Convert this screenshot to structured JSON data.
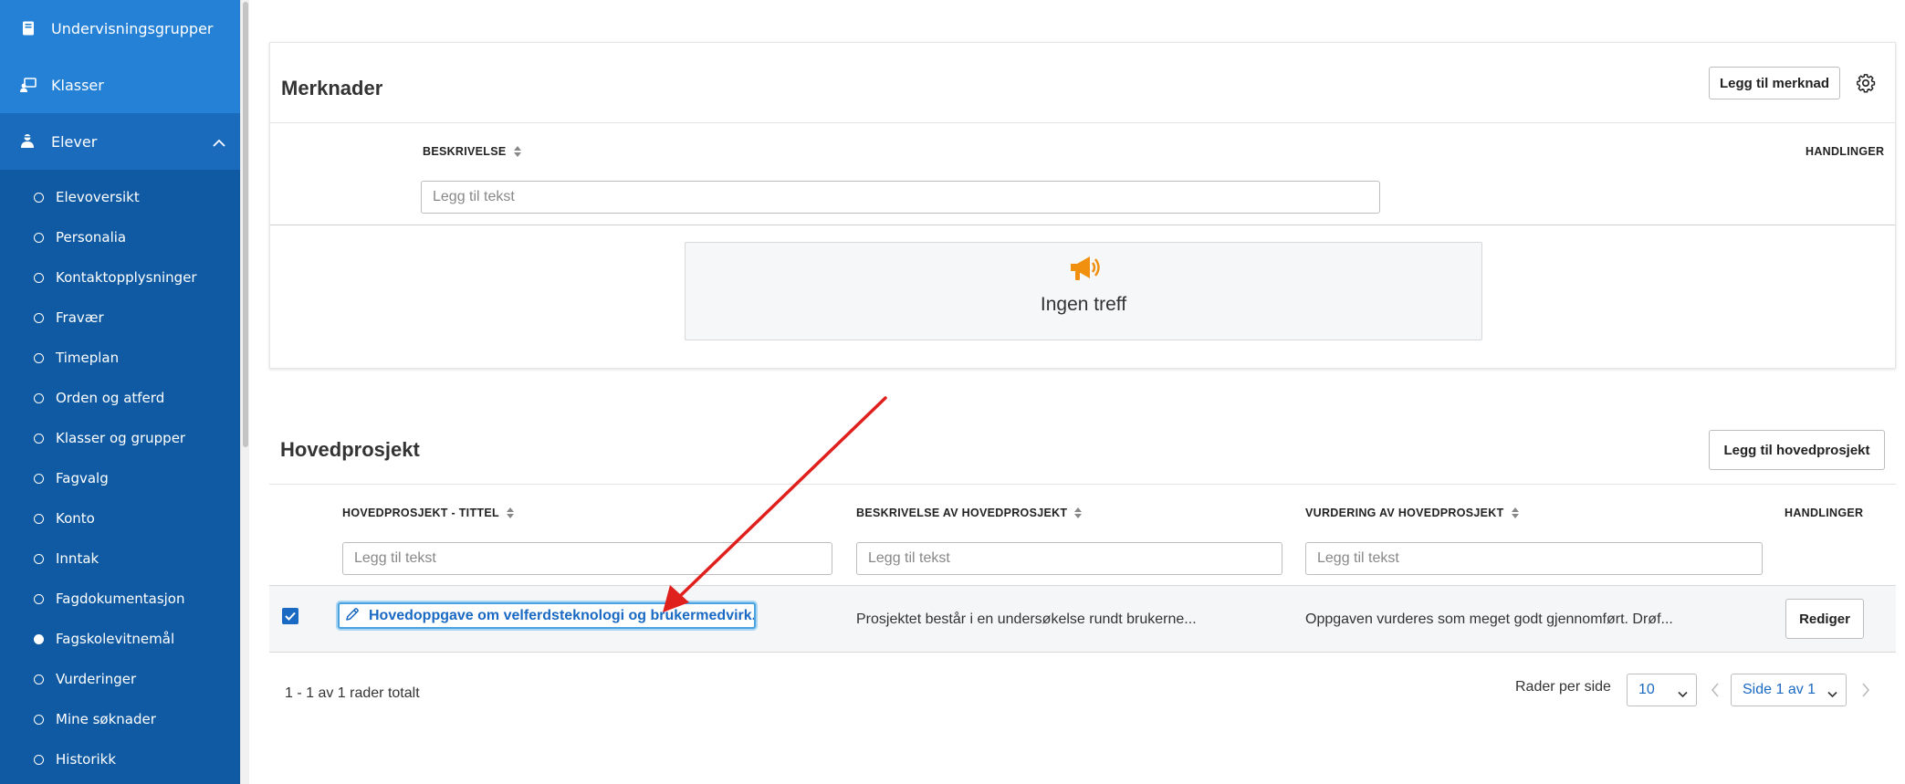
{
  "sidebar": {
    "top_items": [
      {
        "label": "Undervisningsgrupper",
        "icon": "book-icon"
      },
      {
        "label": "Klasser",
        "icon": "classroom-icon"
      }
    ],
    "section": {
      "label": "Elever",
      "icon": "students-icon",
      "expanded": true
    },
    "sub_items": [
      {
        "label": "Elevoversikt",
        "active": false
      },
      {
        "label": "Personalia",
        "active": false
      },
      {
        "label": "Kontaktopplysninger",
        "active": false
      },
      {
        "label": "Fravær",
        "active": false
      },
      {
        "label": "Timeplan",
        "active": false
      },
      {
        "label": "Orden og atferd",
        "active": false
      },
      {
        "label": "Klasser og grupper",
        "active": false
      },
      {
        "label": "Fagvalg",
        "active": false
      },
      {
        "label": "Konto",
        "active": false
      },
      {
        "label": "Inntak",
        "active": false
      },
      {
        "label": "Fagdokumentasjon",
        "active": false
      },
      {
        "label": "Fagskolevitnemål",
        "active": true
      },
      {
        "label": "Vurderinger",
        "active": false
      },
      {
        "label": "Mine søknader",
        "active": false
      },
      {
        "label": "Historikk",
        "active": false
      }
    ],
    "colors": {
      "bg": "#0f5aa3",
      "top_bg": "#2581d6",
      "section_bg": "#1b6bbd"
    }
  },
  "merknader": {
    "title": "Merknader",
    "add_button": "Legg til merknad",
    "columns": {
      "beskrivelse": "BESKRIVELSE",
      "handlinger": "HANDLINGER"
    },
    "filter_placeholder": "Legg til tekst",
    "empty_text": "Ingen treff"
  },
  "hovedprosjekt": {
    "title": "Hovedprosjekt",
    "add_button": "Legg til hovedprosjekt",
    "columns": {
      "tittel": "HOVEDPROSJEKT - TITTEL",
      "beskrivelse": "BESKRIVELSE AV HOVEDPROSJEKT",
      "vurdering": "VURDERING AV HOVEDPROSJEKT",
      "handlinger": "HANDLINGER"
    },
    "filter_placeholder": "Legg til tekst",
    "rows": [
      {
        "checked": true,
        "title": "Hovedoppgave om velferdsteknologi og brukermedvirk...",
        "description": "Prosjektet består i en undersøkelse rundt brukerne...",
        "assessment": "Oppgaven vurderes som meget godt gjennomført. Drøf...",
        "action": "Rediger"
      }
    ],
    "footer": {
      "summary": "1 - 1 av 1 rader totalt",
      "rows_per_page_label": "Rader per side",
      "rows_per_page_value": "10",
      "page_value": "Side 1 av 1"
    }
  },
  "annotation": {
    "arrow_color": "#e0201c"
  },
  "accent_color": "#1a69c3"
}
